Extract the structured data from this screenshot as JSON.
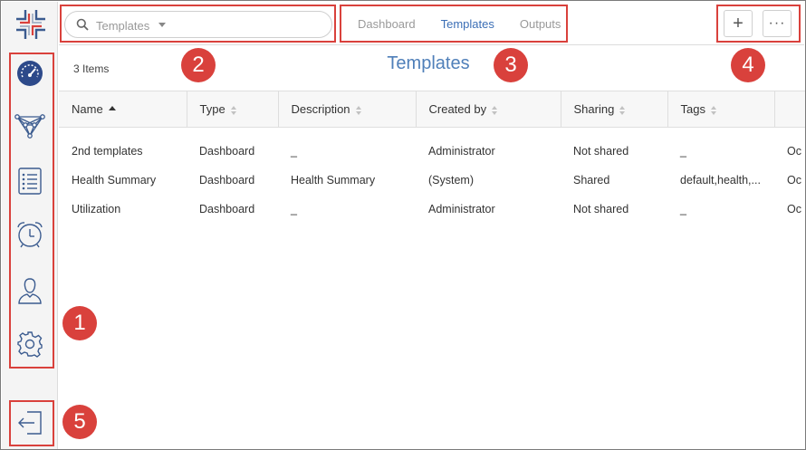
{
  "header": {
    "search": {
      "value": "Templates"
    },
    "tabs": [
      {
        "label": "Dashboard",
        "active": false
      },
      {
        "label": "Templates",
        "active": true
      },
      {
        "label": "Outputs",
        "active": false
      }
    ],
    "add_button_label": "+",
    "more_button_label": "···"
  },
  "sidebar": {
    "items": [
      {
        "name": "dashboard",
        "icon": "speedometer-icon",
        "active": true
      },
      {
        "name": "topology",
        "icon": "network-icon"
      },
      {
        "name": "list",
        "icon": "list-icon"
      },
      {
        "name": "alarms",
        "icon": "alarm-clock-icon"
      },
      {
        "name": "users",
        "icon": "user-icon"
      },
      {
        "name": "settings",
        "icon": "gear-icon"
      }
    ],
    "logout_icon": "logout-icon"
  },
  "main": {
    "items_count": "3 Items",
    "title": "Templates"
  },
  "table": {
    "columns": [
      "Name",
      "Type",
      "Description",
      "Created by",
      "Sharing",
      "Tags",
      ""
    ],
    "rows": [
      [
        "2nd templates",
        "Dashboard",
        "_",
        "Administrator",
        "Not shared",
        "_",
        "Oc"
      ],
      [
        "Health Summary",
        "Dashboard",
        "Health Summary",
        "(System)",
        "Shared",
        "default,health,...",
        "Oc"
      ],
      [
        "Utilization",
        "Dashboard",
        "_",
        "Administrator",
        "Not shared",
        "_",
        "Oc"
      ]
    ]
  },
  "annotations": [
    "1",
    "2",
    "3",
    "4",
    "5"
  ],
  "colors": {
    "accent": "#3c6fb6",
    "annotation": "#d9413c",
    "active_icon_bg": "#2d4a8a"
  }
}
